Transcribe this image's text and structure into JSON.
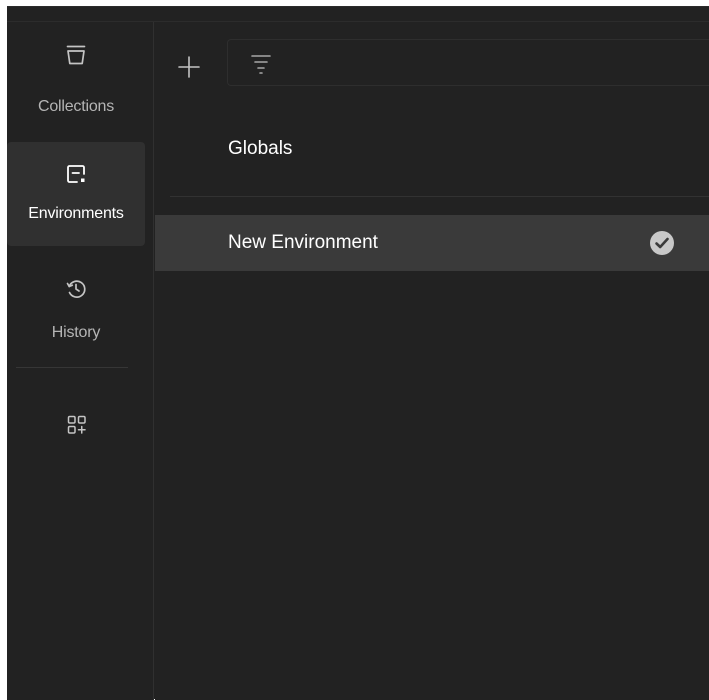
{
  "sidebar": {
    "items": [
      {
        "label": "Collections",
        "icon": "collections-icon"
      },
      {
        "label": "Environments",
        "icon": "environments-icon",
        "active": true
      },
      {
        "label": "History",
        "icon": "history-icon"
      }
    ],
    "extra_icon": "add-widget-icon"
  },
  "toolbar": {
    "add_icon": "plus-icon",
    "filter_icon": "filter-icon"
  },
  "list": {
    "globals_label": "Globals",
    "environments": [
      {
        "name": "New Environment",
        "selected": true,
        "active_icon": "check-circle-icon"
      }
    ]
  },
  "colors": {
    "background": "#222222",
    "active_nav": "#303030",
    "selected_row": "#3a3a3a",
    "text_primary": "#ffffff",
    "text_secondary": "#b5b5b5"
  }
}
